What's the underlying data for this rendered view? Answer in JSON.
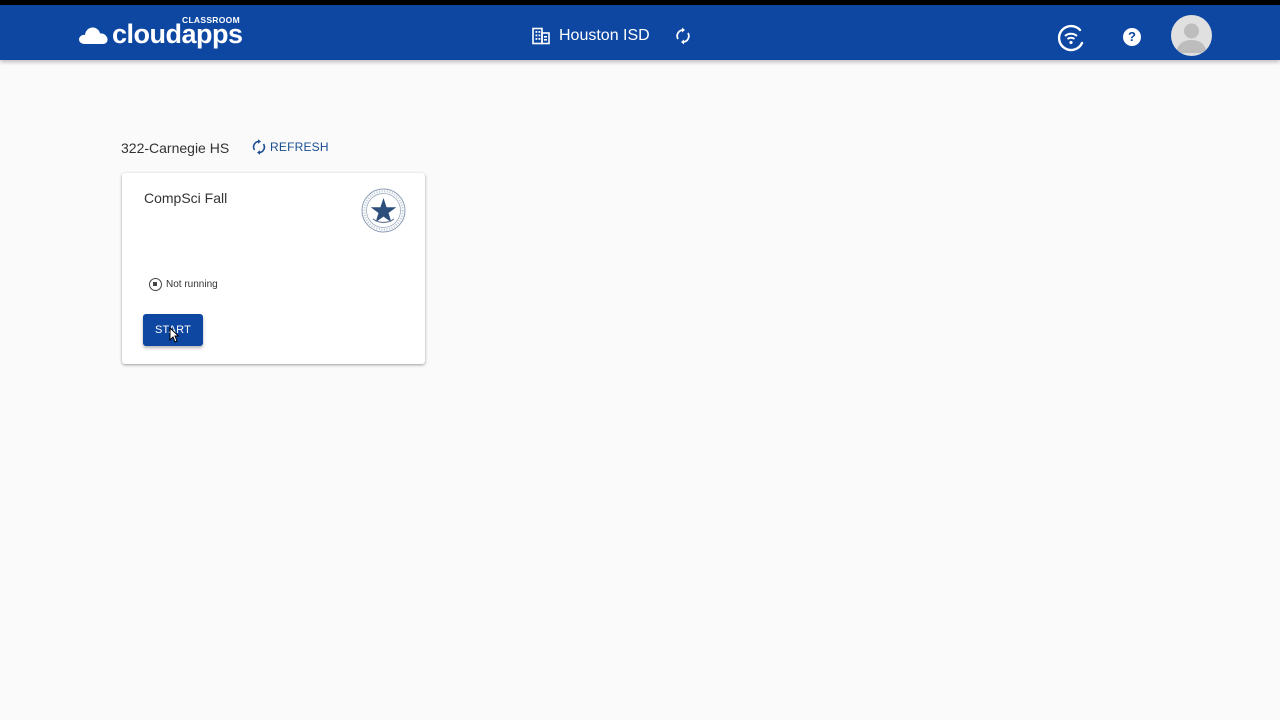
{
  "header": {
    "logo_sup": "CLASSROOM",
    "logo_text": "cloudapps",
    "district_name": "Houston ISD",
    "icons": {
      "district": "building-icon",
      "sync": "sync-icon",
      "network": "network-status-icon",
      "help": "help-icon",
      "avatar": "user-avatar"
    },
    "help_glyph": "?"
  },
  "main": {
    "school_name": "322-Carnegie HS",
    "refresh_label": "REFRESH"
  },
  "card": {
    "title": "CompSci Fall",
    "status_text": "Not running",
    "start_label": "START"
  },
  "colors": {
    "primary": "#0d47a1",
    "background": "#fafafa",
    "link": "#1a4d8f"
  }
}
